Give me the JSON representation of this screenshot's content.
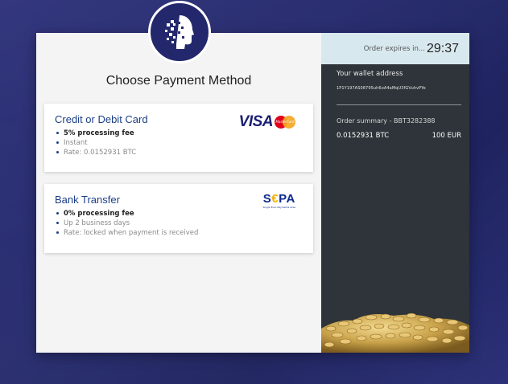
{
  "page": {
    "title": "Choose Payment Method"
  },
  "methods": [
    {
      "name": "Credit or Debit Card",
      "brand_icon": "visa-mastercard-logo",
      "brand_text": "VISA",
      "brand_subtext": "MasterCard",
      "features": [
        "5% processing fee",
        "Instant",
        "Rate: 0.0152931 BTC"
      ]
    },
    {
      "name": "Bank Transfer",
      "brand_icon": "sepa-logo",
      "brand_text": "S€PA",
      "brand_subtext": "Single Euro Payments Area",
      "features": [
        "0% processing fee",
        "Up 2 business days",
        "Rate: locked when payment is received"
      ]
    }
  ],
  "order": {
    "expires_label": "Order expires in...",
    "expires_value": "29:37",
    "wallet_label": "Your wallet address",
    "wallet_address": "1P1Y197AS08795uh6oA4aMqU3fGVuhvPYe",
    "summary_label": "Order summary - BBT3282388",
    "amount_btc": "0.0152931 BTC",
    "amount_eur": "100 EUR"
  },
  "colors": {
    "background": "#262b6e",
    "accent_blue": "#1c3f86",
    "sidebar": "#2e3439",
    "timer_bar": "#d8e8ef",
    "coins_gold": "#c9a24a"
  },
  "icons": {
    "logo": "robot-head-logo",
    "coins": "gold-coins-pile"
  }
}
